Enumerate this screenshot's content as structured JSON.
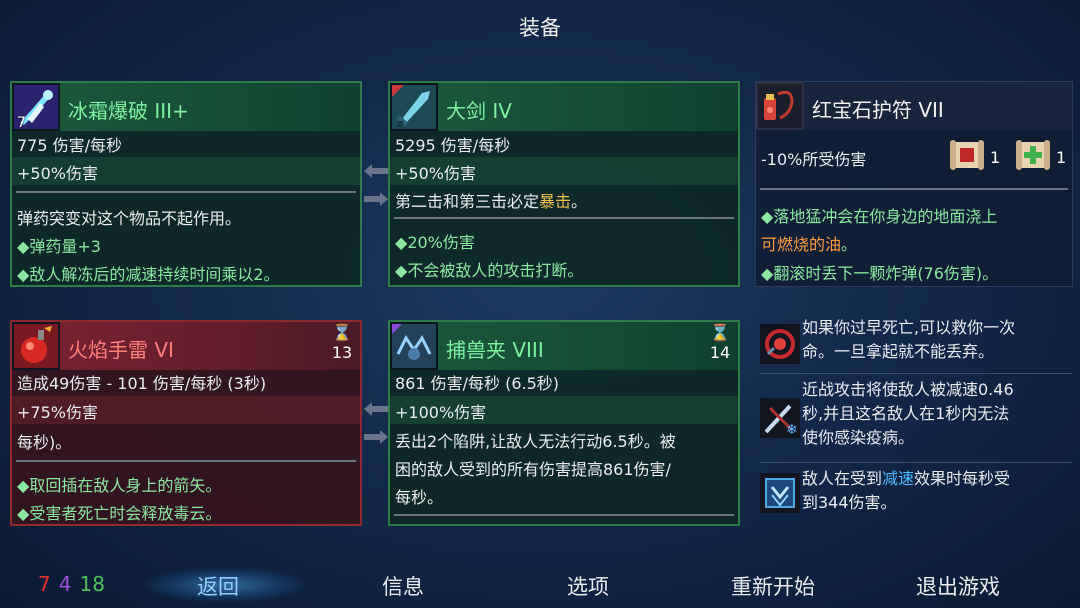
{
  "title": "装备",
  "colors": {
    "green_border": "#2f7a49",
    "red_border": "#8d2a2e",
    "highlight_yellow": "#f0c04a",
    "highlight_orange": "#ff9a3d",
    "highlight_blue": "#4fb8ff",
    "stat_brutality": "#e03030",
    "stat_tactics": "#a04ee0",
    "stat_survival": "#4fbf5a"
  },
  "cards": {
    "frost_blast": {
      "name": "冰霜爆破  III+",
      "icon": "frost-blast-icon",
      "count": "7",
      "dps": "775  伤害/每秒",
      "bonus": "+50%伤害",
      "lines": [
        "弹药突变对这个物品不起作用。",
        "弹药量+3",
        "敌人解冻后的减速持续时间乘以2。"
      ]
    },
    "broadsword": {
      "name": "大剑  IV",
      "icon": "broadsword-icon",
      "dps": "5295  伤害/每秒",
      "bonus": "+50%伤害",
      "effect_pre": "第二击和第三击必定",
      "effect_hl": "暴击",
      "effect_post": "。",
      "lines": [
        "20%伤害",
        "不会被敌人的攻击打断。"
      ]
    },
    "ruby_amulet": {
      "name": "红宝石护符  VII",
      "icon": "amulet-icon",
      "stat": "-10%所受伤害",
      "scrolls": [
        {
          "icon": "scroll-brutality-icon",
          "count": "1"
        },
        {
          "icon": "scroll-health-icon",
          "count": "1"
        }
      ],
      "line1": "落地猛冲会在你身边的地面浇上",
      "line2_hl": "可燃烧的油",
      "line2_post": "。",
      "line3": "翻滚时丢下一颗炸弹(76伤害)。"
    },
    "fire_grenade": {
      "name": "火焰手雷  VI",
      "icon": "fire-grenade-icon",
      "timer_icon": "hourglass-icon",
      "cooldown": "13",
      "dps": "造成49伤害 - 101 伤害/每秒 (3秒)",
      "bonus": "+75%伤害",
      "extra": "每秒)。",
      "lines": [
        "取回插在敌人身上的箭矢。",
        "受害者死亡时会释放毒云。"
      ]
    },
    "wolf_trap": {
      "name": "捕兽夹  VIII",
      "icon": "wolf-trap-icon",
      "timer_icon": "hourglass-icon",
      "cooldown": "14",
      "dps": "861  伤害/每秒  (6.5秒)",
      "bonus": "+100%伤害",
      "desc": [
        "丢出2个陷阱,让敌人无法行动6.5秒。被",
        "困的敌人受到的所有伤害提高861伤害/",
        "每秒。"
      ]
    }
  },
  "mutations": [
    {
      "icon": "revive-mutation-icon",
      "lines": [
        "如果你过早死亡,可以救你一次",
        "命。一旦拿起就不能丢弃。"
      ]
    },
    {
      "icon": "frost-melee-mutation-icon",
      "lines": [
        "近战攻击将使敌人被减速0.46",
        "秒,并且这名敌人在1秒内无法",
        "使你感染疫病。"
      ]
    },
    {
      "icon": "slow-damage-mutation-icon",
      "pre": "敌人在受到",
      "hl": "减速",
      "post": "效果时每秒受",
      "line2": "到344伤害。"
    }
  ],
  "bottom": {
    "stats": {
      "brutality": "7",
      "tactics": "4",
      "survival": "18"
    },
    "nav": [
      "返回",
      "信息",
      "选项",
      "重新开始",
      "退出游戏"
    ]
  }
}
